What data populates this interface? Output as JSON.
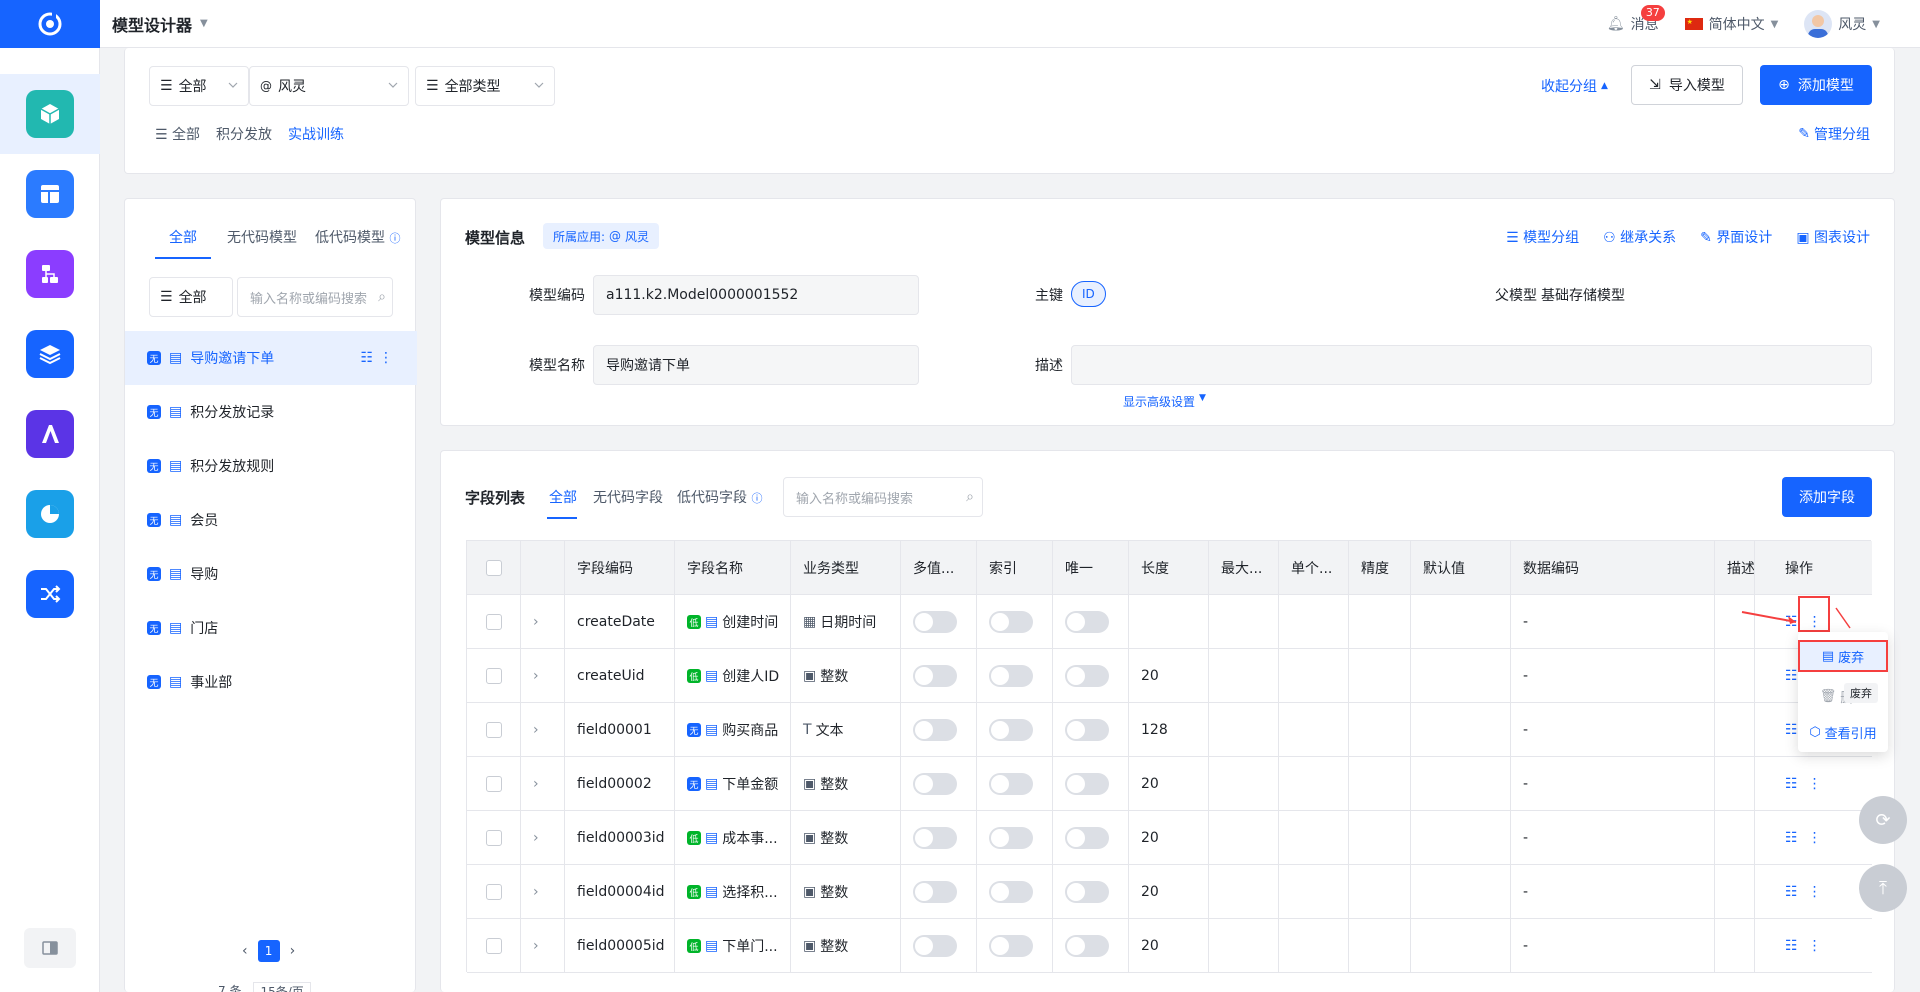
{
  "app": {
    "title": "模型设计器"
  },
  "topbar": {
    "messages_label": "消息",
    "messages_count": "37",
    "language": "简体中文",
    "user_name": "风灵"
  },
  "sidebar": {
    "items": [
      {
        "icon": "cube-icon",
        "color": "#22b8b0"
      },
      {
        "icon": "layout-icon",
        "color": "#2b7bff"
      },
      {
        "icon": "flow-icon",
        "color": "#8b3dff"
      },
      {
        "icon": "layers-icon",
        "color": "#1664ff"
      },
      {
        "icon": "ai-icon",
        "color": "#5b34e6"
      },
      {
        "icon": "chart-pie-icon",
        "color": "#1aa0e8"
      },
      {
        "icon": "shuffle-icon",
        "color": "#1664ff"
      }
    ]
  },
  "filters": {
    "scope": "全部",
    "owner": "风灵",
    "type": "全部类型",
    "collapse_group": "收起分组",
    "import_model": "导入模型",
    "add_model": "添加模型",
    "manage_group": "管理分组",
    "group_tabs": [
      "全部",
      "积分发放",
      "实战训练"
    ]
  },
  "model_panel": {
    "tabs": [
      "全部",
      "无代码模型",
      "低代码模型"
    ],
    "filter": "全部",
    "search_placeholder": "输入名称或编码搜索",
    "tag_label": "无",
    "items": [
      "导购邀请下单",
      "积分发放记录",
      "积分发放规则",
      "会员",
      "导购",
      "门店",
      "事业部"
    ],
    "page": "1",
    "footer_total": "7 条",
    "footer_size": "15条/页"
  },
  "model_info": {
    "title": "模型信息",
    "app_label": "所属应用:",
    "app_name": "风灵",
    "actions": [
      "模型分组",
      "继承关系",
      "界面设计",
      "图表设计"
    ],
    "code_label": "模型编码",
    "code_value": "a111.k2.Model0000001552",
    "pk_label": "主键",
    "pk_value": "ID",
    "parent_label": "父模型",
    "parent_value": "基础存储模型",
    "name_label": "模型名称",
    "name_value": "导购邀请下单",
    "desc_label": "描述",
    "advanced": "显示高级设置"
  },
  "fields": {
    "title": "字段列表",
    "tabs": [
      "全部",
      "无代码字段",
      "低代码字段"
    ],
    "search_placeholder": "输入名称或编码搜索",
    "add_button": "添加字段",
    "columns": [
      "字段编码",
      "字段名称",
      "业务类型",
      "多值...",
      "索引",
      "唯一",
      "长度",
      "最大...",
      "单个...",
      "精度",
      "默认值",
      "数据编码",
      "描述",
      "操作"
    ],
    "rows": [
      {
        "code": "createDate",
        "tag": "低",
        "name": "创建时间",
        "type_icon": "calendar-icon",
        "type": "日期时间",
        "length": "",
        "data_code": "-"
      },
      {
        "code": "createUid",
        "tag": "低",
        "name": "创建人ID",
        "type_icon": "number-icon",
        "type": "整数",
        "length": "20",
        "data_code": "-"
      },
      {
        "code": "field00001",
        "tag": "无",
        "name": "购买商品",
        "type_icon": "text-icon",
        "type": "文本",
        "length": "128",
        "data_code": "-"
      },
      {
        "code": "field00002",
        "tag": "无",
        "name": "下单金额",
        "type_icon": "number-icon",
        "type": "整数",
        "length": "20",
        "data_code": "-"
      },
      {
        "code": "field00003id",
        "tag": "低",
        "name": "成本事...",
        "type_icon": "number-icon",
        "type": "整数",
        "length": "20",
        "data_code": "-"
      },
      {
        "code": "field00004id",
        "tag": "低",
        "name": "选择积...",
        "type_icon": "number-icon",
        "type": "整数",
        "length": "20",
        "data_code": "-"
      },
      {
        "code": "field00005id",
        "tag": "低",
        "name": "下单门...",
        "type_icon": "number-icon",
        "type": "整数",
        "length": "20",
        "data_code": "-"
      }
    ]
  },
  "row_menu": {
    "discard": "废弃",
    "delete": "删除",
    "view_refs": "查看引用",
    "tooltip": "废弃"
  }
}
